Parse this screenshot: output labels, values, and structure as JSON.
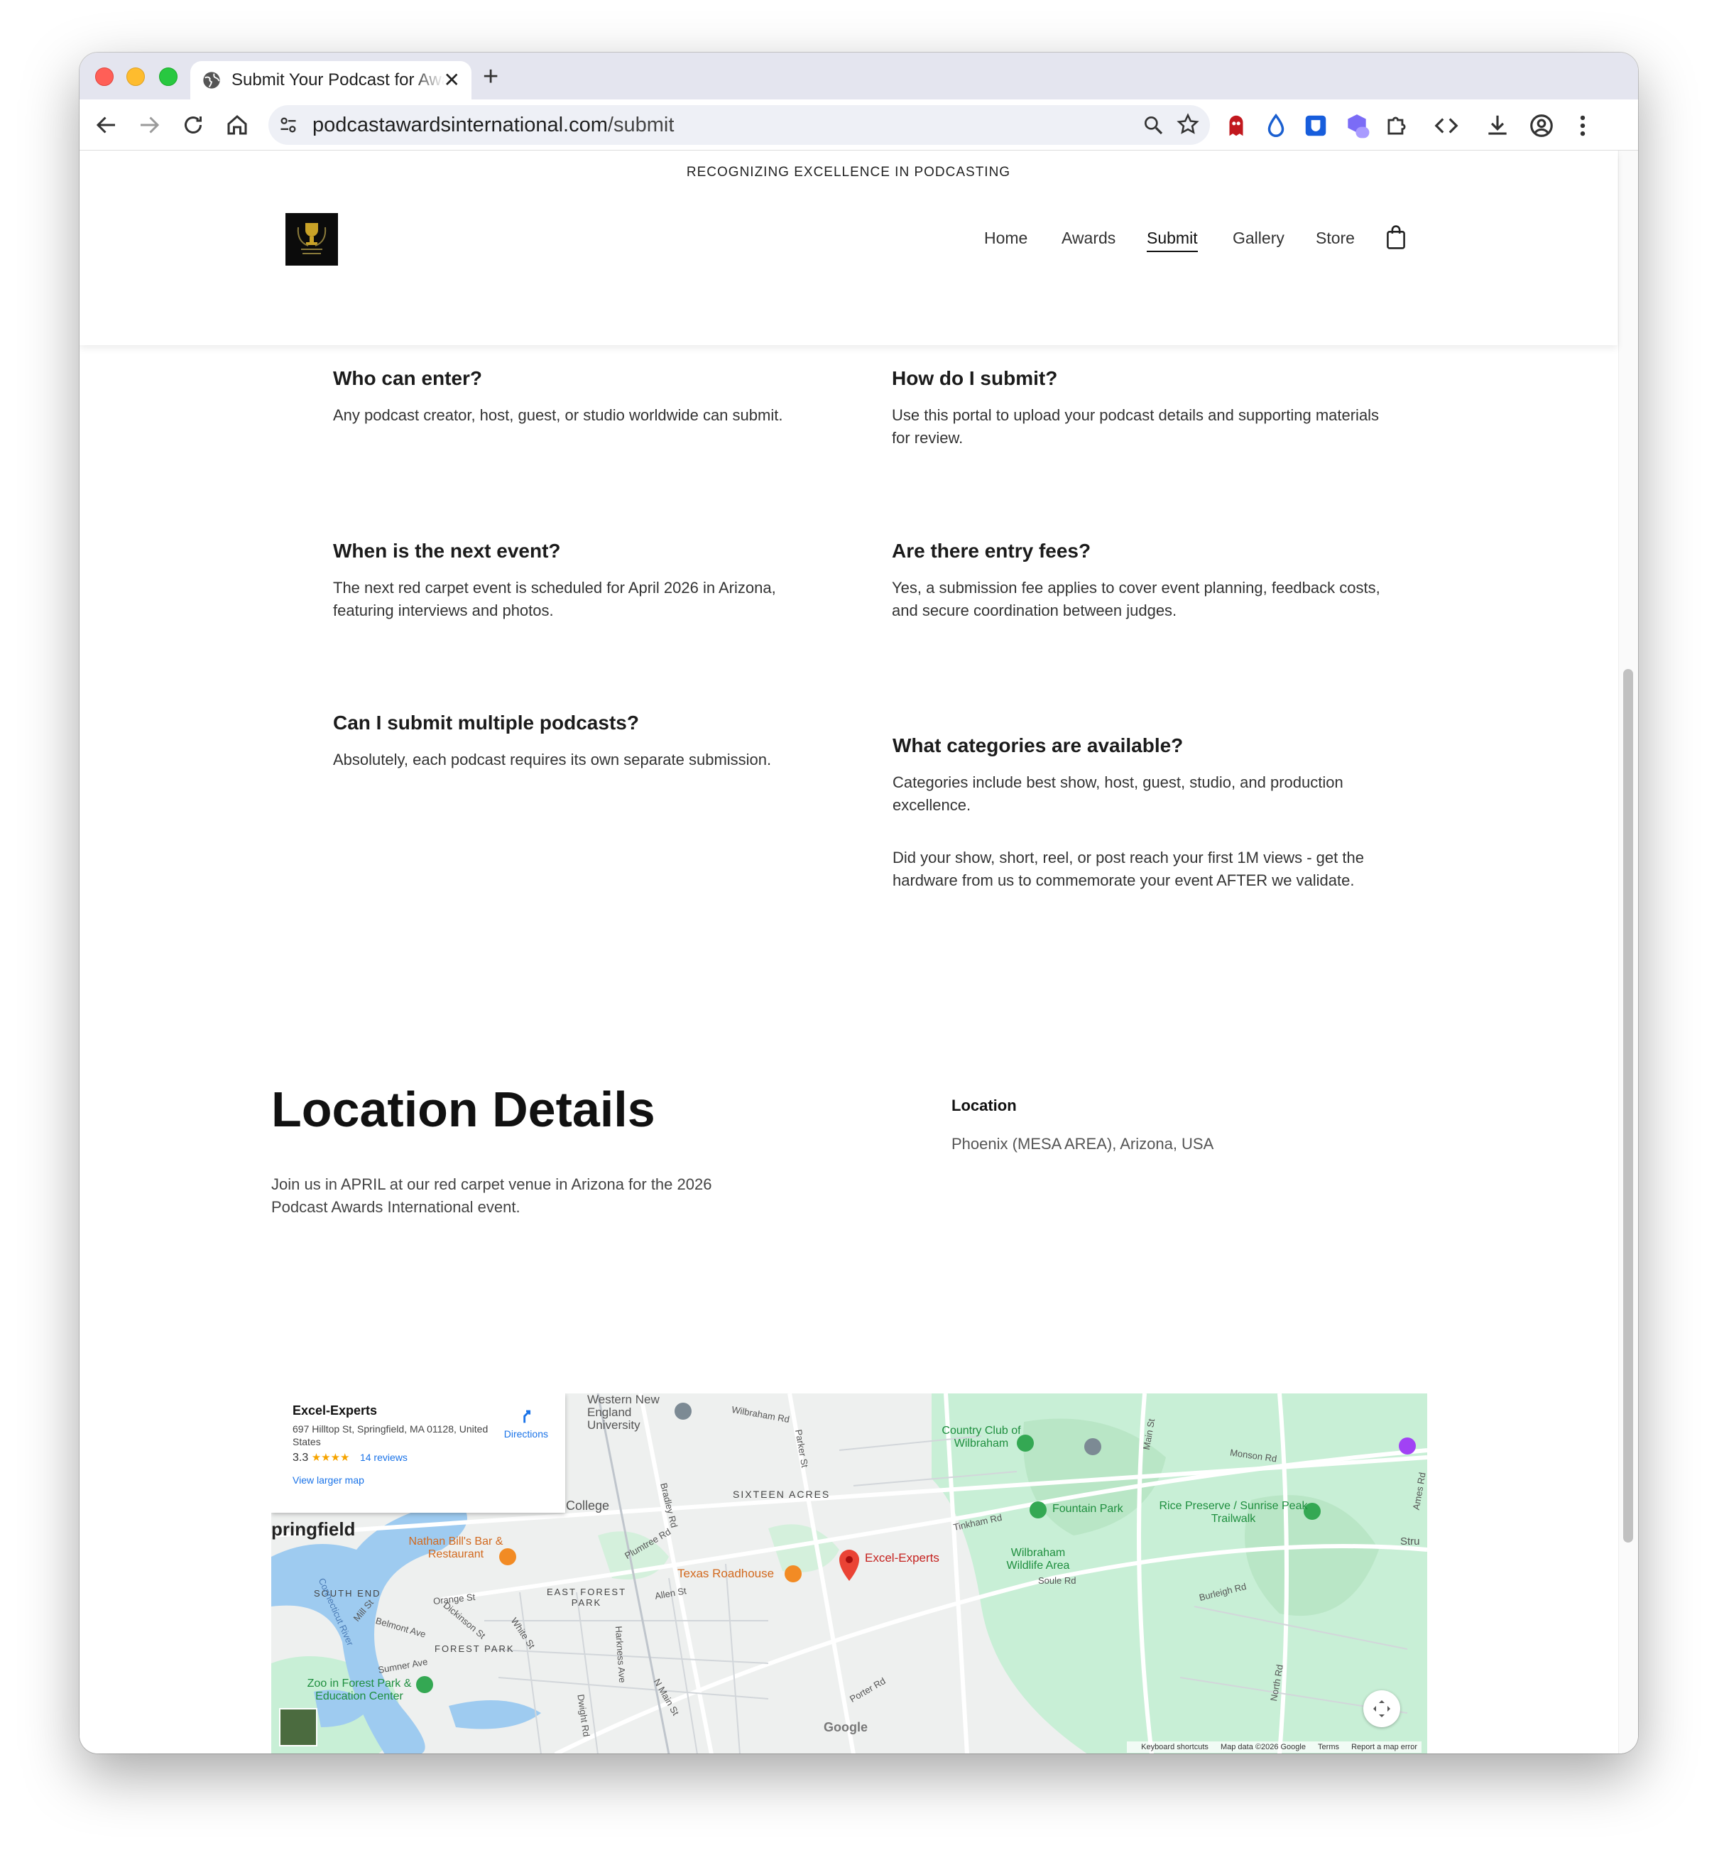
{
  "browser": {
    "tab_title": "Submit Your Podcast for Awards",
    "url_host": "podcastawardsinternational.com",
    "url_path": "/submit"
  },
  "site": {
    "tagline": "RECOGNIZING EXCELLENCE IN PODCASTING",
    "nav": [
      {
        "label": "Home"
      },
      {
        "label": "Awards"
      },
      {
        "label": "Submit"
      },
      {
        "label": "Gallery"
      },
      {
        "label": "Store"
      }
    ],
    "active_nav": "Submit"
  },
  "faq": [
    {
      "q": "Who can enter?",
      "a": "Any podcast creator, host, guest, or studio worldwide can submit."
    },
    {
      "q": "How do I submit?",
      "a": "Use this portal to upload your podcast details and supporting materials for review."
    },
    {
      "q": "When is the next event?",
      "a": "The next red carpet event is scheduled for April 2026 in Arizona, featuring interviews and photos."
    },
    {
      "q": "Are there entry fees?",
      "a": "Yes, a submission fee applies to cover event planning, feedback costs, and secure coordination between judges."
    },
    {
      "q": "Can I submit multiple podcasts?",
      "a": "Absolutely, each podcast requires its own separate submission."
    },
    {
      "q": "What categories are available?",
      "a": "Categories include best show, host, guest, studio, and production excellence."
    }
  ],
  "extra_note": "Did your show, short, reel, or post reach your first 1M views - get the hardware from us to commemorate your event AFTER we validate.",
  "location": {
    "title": "Location Details",
    "description": "Join us in APRIL at our red carpet venue in Arizona for the 2026 Podcast Awards International event.",
    "label": "Location",
    "value": "Phoenix (MESA AREA), Arizona, USA"
  },
  "map": {
    "place_name": "Excel-Experts",
    "address": "697 Hilltop St, Springfield, MA 01128, United States",
    "rating": "3.3",
    "stars": "★★★★",
    "reviews": "14 reviews",
    "directions": "Directions",
    "larger_map": "View larger map",
    "footer": [
      "Keyboard shortcuts",
      "Map data ©2026 Google",
      "Terms",
      "Report a map error"
    ],
    "google": "Google",
    "labels": {
      "wne": "Western New England University",
      "college": "College",
      "springfield": "pringfield",
      "nathan": "Nathan Bill's Bar & Restaurant",
      "texas": "Texas Roadhouse",
      "sixteen": "SIXTEEN ACRES",
      "excel": "Excel-Experts",
      "east_forest": "EAST FOREST PARK",
      "forest_park": "FOREST PARK",
      "south_end": "SOUTH END",
      "zoo": "Zoo in Forest Park & Education Center",
      "cc_wilbraham": "Country Club of Wilbraham",
      "fountain": "Fountain Park",
      "rice": "Rice Preserve / Sunrise Peak Trailwalk",
      "wilbraham_wa": "Wilbraham Wildlife Area",
      "monson": "Monson Rd",
      "burleigh": "Burleigh Rd",
      "soule": "Soule Rd",
      "tinkham": "Tinkham Rd",
      "allen": "Allen St",
      "wilbraham_rd": "Wilbraham Rd",
      "parker": "Parker St",
      "main": "Main St",
      "north_rd": "North Rd",
      "orange": "Orange St",
      "sumner": "Sumner Ave",
      "belmont": "Belmont Ave",
      "mill": "Mill St",
      "harkness": "Harkness Ave",
      "dwight": "Dwight Rd",
      "n_main": "N Main St",
      "porter": "Porter Rd",
      "bradley": "Bradley Rd",
      "plumtree": "Plumtree Rd",
      "ct_river": "Connecticut River",
      "dickinson": "Dickinson St",
      "white": "White St",
      "stru": "Stru",
      "ames": "Ames Rd"
    }
  }
}
